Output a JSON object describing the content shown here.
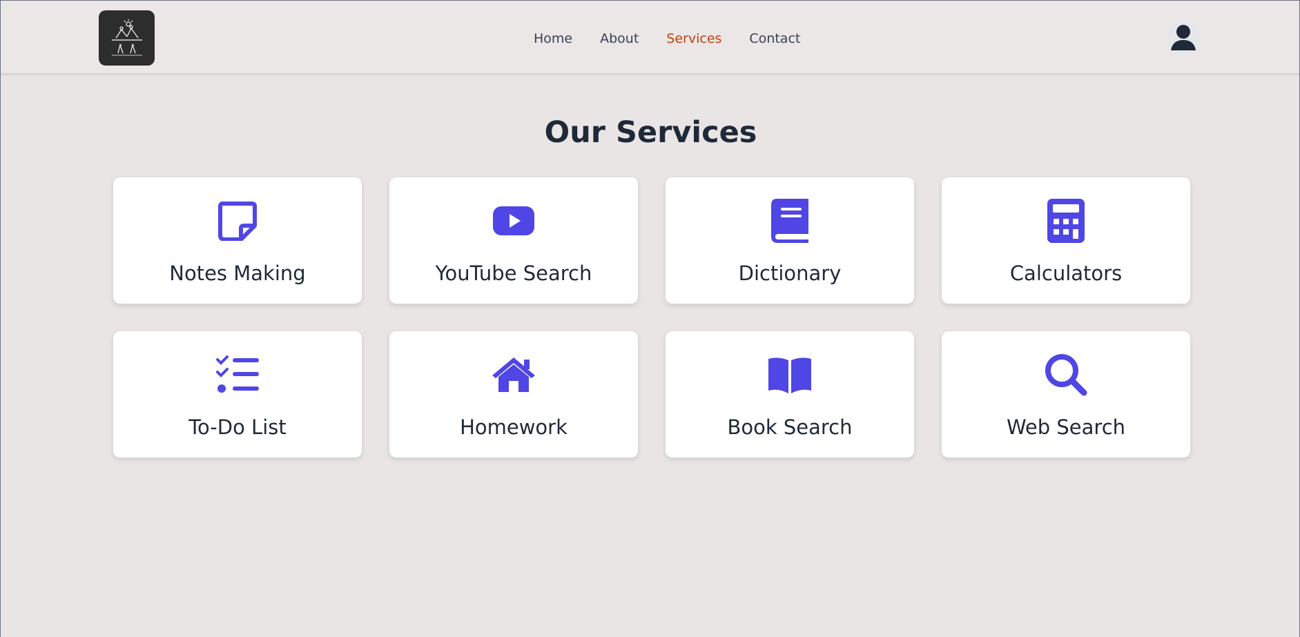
{
  "header": {
    "logo_alt": "Logo",
    "nav": [
      {
        "label": "Home",
        "active": false
      },
      {
        "label": "About",
        "active": false
      },
      {
        "label": "Services",
        "active": true
      },
      {
        "label": "Contact",
        "active": false
      }
    ]
  },
  "main": {
    "title": "Our Services",
    "services": [
      {
        "label": "Notes Making",
        "icon": "sticky-note-icon"
      },
      {
        "label": "YouTube Search",
        "icon": "youtube-icon"
      },
      {
        "label": "Dictionary",
        "icon": "book-icon"
      },
      {
        "label": "Calculators",
        "icon": "calculator-icon"
      },
      {
        "label": "To-Do List",
        "icon": "list-check-icon"
      },
      {
        "label": "Homework",
        "icon": "home-icon"
      },
      {
        "label": "Book Search",
        "icon": "book-open-icon"
      },
      {
        "label": "Web Search",
        "icon": "search-icon"
      }
    ]
  },
  "colors": {
    "background": "#e9e5e5",
    "accent": "#4f46e5",
    "nav_active": "#c2410c",
    "text": "#1f2937"
  }
}
